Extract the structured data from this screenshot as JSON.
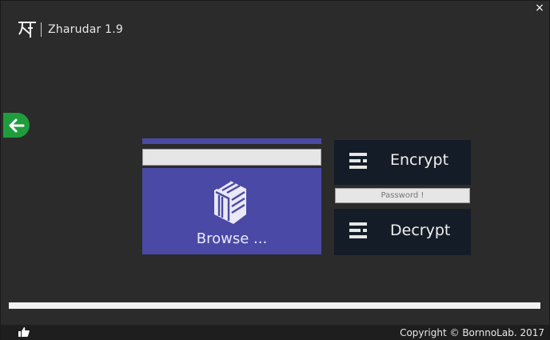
{
  "app": {
    "title": "Zharudar 1.9",
    "close_label": "×",
    "brand_color": "#4a49a6"
  },
  "file": {
    "path_value": "",
    "path_placeholder": "",
    "browse_label": "Browse ..."
  },
  "actions": {
    "encrypt_label": "Encrypt",
    "decrypt_label": "Decrypt"
  },
  "password": {
    "placeholder": "Password !",
    "value": ""
  },
  "progress": {
    "value": 0
  },
  "footer": {
    "copyright": "Copyright © BornnoLab. 2017"
  },
  "icons": {
    "logo": "bengali-letter-logo-icon",
    "back": "arrow-left-icon",
    "browse": "folder-cube-icon",
    "action": "list-lines-icon",
    "like": "thumbs-up-icon"
  }
}
